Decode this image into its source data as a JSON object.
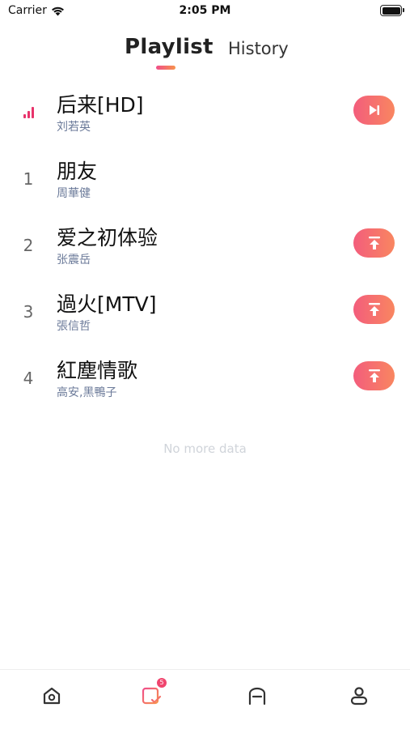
{
  "status_bar": {
    "carrier": "Carrier",
    "time": "2:05 PM"
  },
  "tabs": {
    "playlist": "Playlist",
    "history": "History"
  },
  "songs": [
    {
      "index": "",
      "title": "后来[HD]",
      "artist": "刘若英",
      "action": "play-next-icon"
    },
    {
      "index": "1",
      "title": "朋友",
      "artist": "周華健",
      "action": ""
    },
    {
      "index": "2",
      "title": "爱之初体验",
      "artist": "张震岳",
      "action": "move-top-icon"
    },
    {
      "index": "3",
      "title": "過火[MTV]",
      "artist": "張信哲",
      "action": "move-top-icon"
    },
    {
      "index": "4",
      "title": "紅塵情歌",
      "artist": "高安,黑鴨子",
      "action": "move-top-icon"
    }
  ],
  "footer_text": "No more data",
  "nav": {
    "playlist_badge": "5"
  },
  "colors": {
    "accent_start": "#f35d7c",
    "accent_end": "#f98660",
    "playing": "#e8336b"
  }
}
